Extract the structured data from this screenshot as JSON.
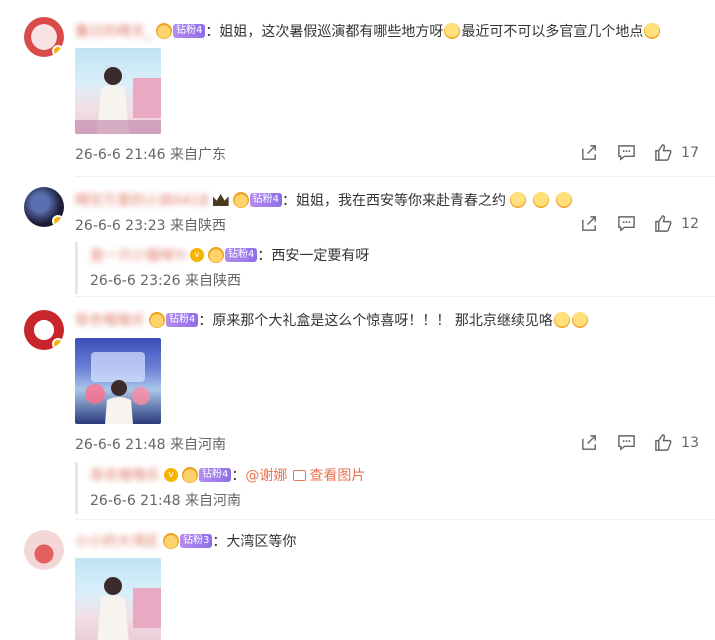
{
  "comments": [
    {
      "username": "叠日的晴天_",
      "fan_level": "钻粉4",
      "text": "：姐姐，这次暑假巡演都有哪些地方呀",
      "text_after": "最近可不可以多官宣几个地点",
      "time": "26-6-6 21:46",
      "location": "来自广东",
      "likes": "17"
    },
    {
      "username": "晴空万里的小孩0418",
      "fan_level": "钻粉4",
      "text": "：姐姐，我在西安等你来赴青春之约",
      "time": "26-6-6 23:23",
      "location": "来自陕西",
      "likes": "12",
      "reply": {
        "username": "是一只小猫咪Yi",
        "fan_level": "钻粉4",
        "text": "：西安一定要有呀",
        "time": "26-6-6 23:26",
        "location": "来自陕西"
      }
    },
    {
      "username": "菲衣哦哦乐",
      "fan_level": "钻粉4",
      "text": "：原来那个大礼盒是这么个惊喜呀！！！ 那北京继续见咯",
      "time": "26-6-6 21:48",
      "location": "来自河南",
      "likes": "13",
      "reply": {
        "username": "菲衣哦哦乐",
        "fan_level": "钻粉4",
        "text_prefix": "：",
        "mention": "@谢娜",
        "pic_label": "查看图片",
        "time": "26-6-6 21:48",
        "location": "来自河南"
      }
    },
    {
      "username": "小小的大湾区",
      "fan_level": "钻粉3",
      "text": "：大湾区等你"
    }
  ],
  "colors": {
    "username": "#eb7350",
    "text": "#333333",
    "meta": "#666666",
    "fan_badge": "#9b7bea",
    "verified": "#f5b400"
  },
  "icons": [
    "share-icon",
    "comment-icon",
    "like-icon"
  ]
}
